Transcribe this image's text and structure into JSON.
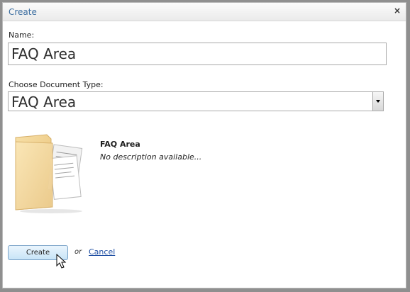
{
  "dialog": {
    "title": "Create",
    "close_label": "×"
  },
  "form": {
    "name_label": "Name:",
    "name_value": "FAQ Area",
    "doctype_label": "Choose Document Type:",
    "doctype_selected": "FAQ Area"
  },
  "preview": {
    "icon": "folder-with-documents-icon",
    "title": "FAQ Area",
    "description": "No description available..."
  },
  "actions": {
    "create_label": "Create",
    "or_text": "or",
    "cancel_label": "Cancel"
  }
}
